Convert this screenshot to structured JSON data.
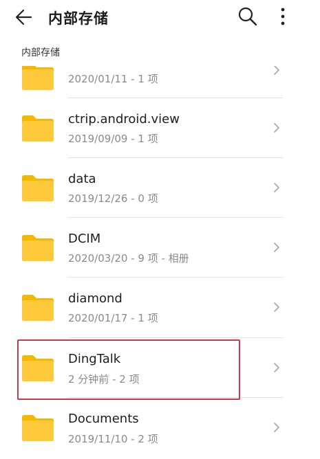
{
  "appbar": {
    "title": "内部存储",
    "back_icon": "arrow-left-icon",
    "search_icon": "search-icon",
    "more_icon": "more-vertical-icon"
  },
  "breadcrumb": "内部存储",
  "colors": {
    "folder": "#FFC93C",
    "folder_tab": "#F5B800",
    "highlight_border": "#C8394A",
    "text_primary": "#1D1D1D",
    "text_secondary": "#8A8A8A",
    "divider": "#E2E2E2"
  },
  "files": [
    {
      "name": "",
      "meta": "2020/01/11 - 1 项"
    },
    {
      "name": "ctrip.android.view",
      "meta": "2019/09/09 - 1 项"
    },
    {
      "name": "data",
      "meta": "2019/12/26 - 0 项"
    },
    {
      "name": "DCIM",
      "meta": "2020/03/20 - 9 项 - 相册"
    },
    {
      "name": "diamond",
      "meta": "2020/01/17 - 1 项"
    },
    {
      "name": "DingTalk",
      "meta": "2 分钟前 - 2 项",
      "highlighted": true
    },
    {
      "name": "Documents",
      "meta": "2019/11/10 - 2 项"
    }
  ]
}
